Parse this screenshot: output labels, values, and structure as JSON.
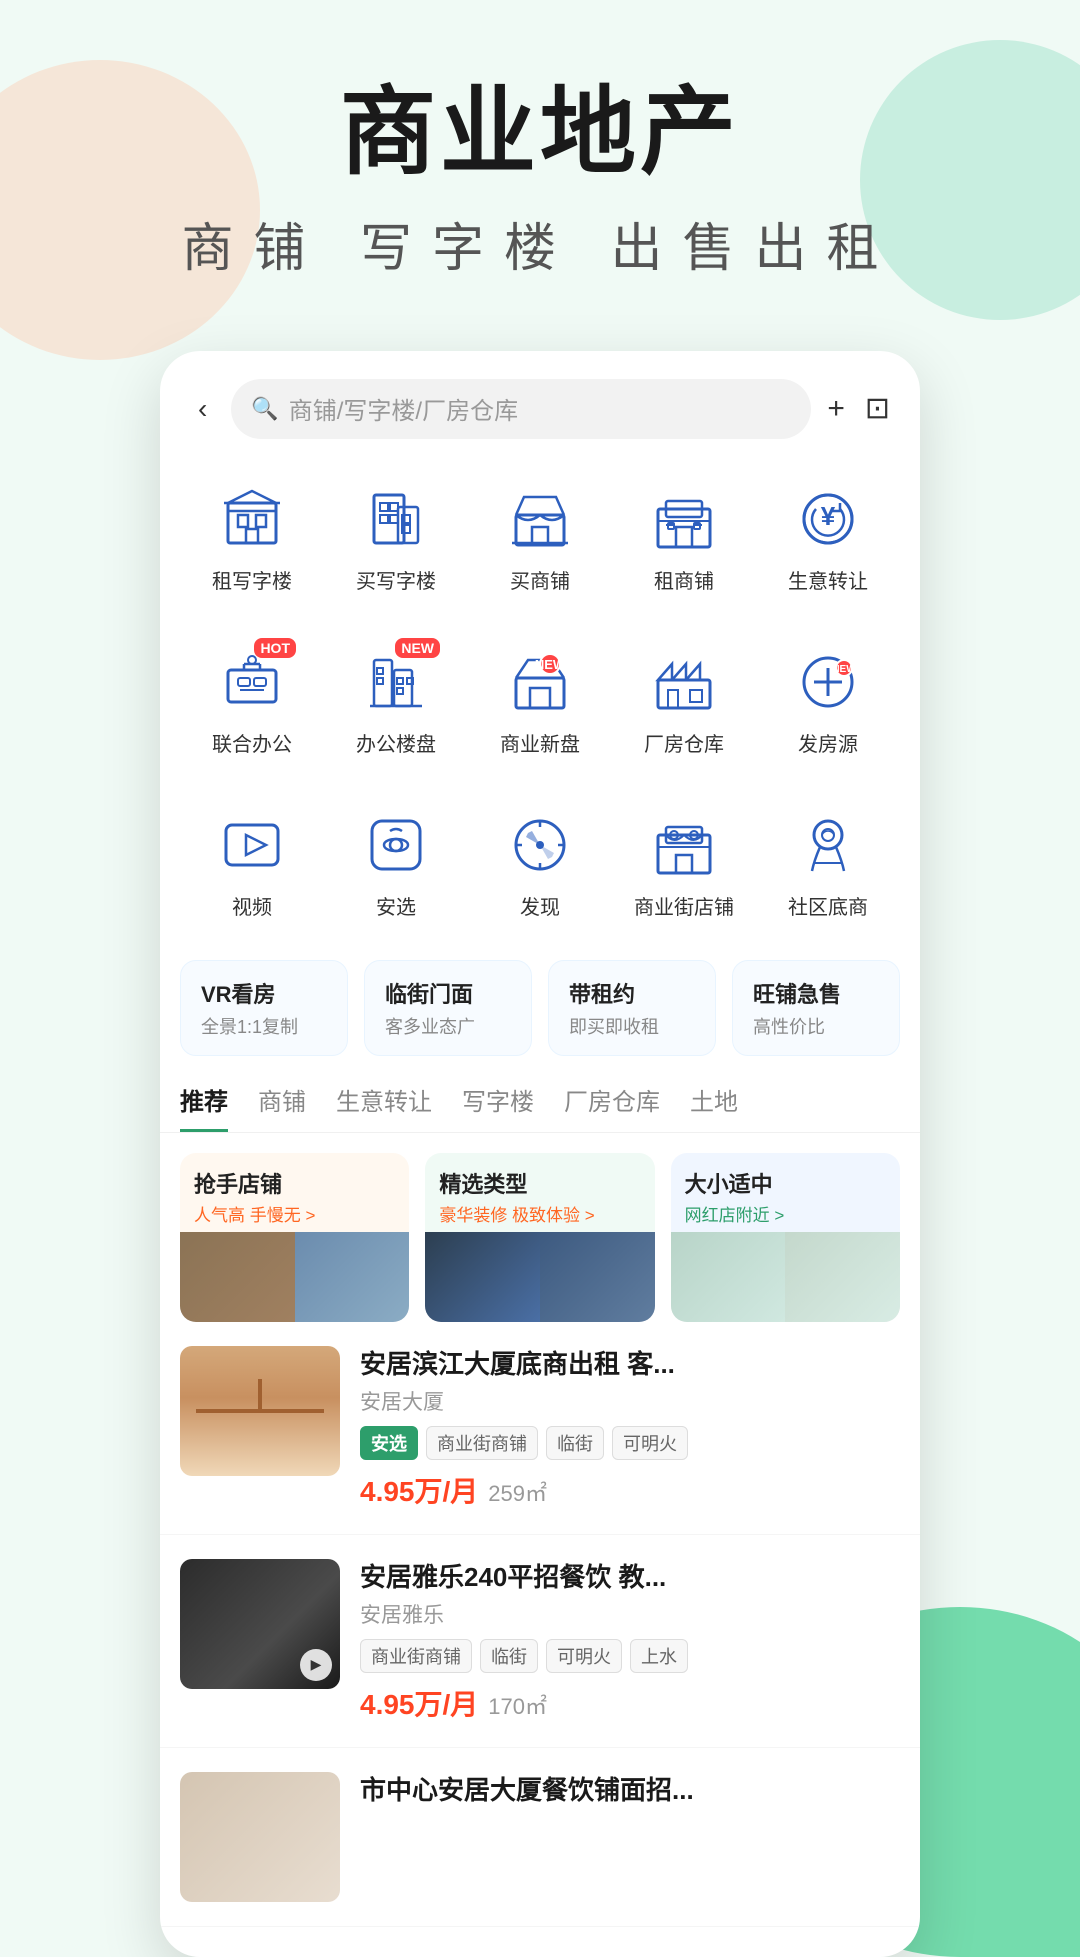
{
  "page": {
    "title": "商业地产",
    "subtitle": "商铺  写字楼  出售出租"
  },
  "topbar": {
    "back_label": "‹",
    "search_placeholder": "商铺/写字楼/厂房仓库",
    "add_icon": "+",
    "message_icon": "⊡"
  },
  "categories_row1": [
    {
      "id": "rent-office",
      "label": "租写字楼",
      "badge": null
    },
    {
      "id": "buy-office",
      "label": "买写字楼",
      "badge": null
    },
    {
      "id": "buy-shop",
      "label": "买商铺",
      "badge": null
    },
    {
      "id": "rent-shop",
      "label": "租商铺",
      "badge": null
    },
    {
      "id": "transfer-biz",
      "label": "生意转让",
      "badge": null
    }
  ],
  "categories_row2": [
    {
      "id": "cowork",
      "label": "联合办公",
      "badge": "HOT"
    },
    {
      "id": "office-disk",
      "label": "办公楼盘",
      "badge": "NEW"
    },
    {
      "id": "commercial-new",
      "label": "商业新盘",
      "badge": "NEW"
    },
    {
      "id": "factory",
      "label": "厂房仓库",
      "badge": null
    },
    {
      "id": "post-source",
      "label": "发房源",
      "badge": "NEW"
    }
  ],
  "categories_row3": [
    {
      "id": "video",
      "label": "视频",
      "badge": null
    },
    {
      "id": "anxuan",
      "label": "安选",
      "badge": null
    },
    {
      "id": "discover",
      "label": "发现",
      "badge": null
    },
    {
      "id": "comm-shop",
      "label": "商业街店铺",
      "badge": null
    },
    {
      "id": "community-shop",
      "label": "社区底商",
      "badge": null
    }
  ],
  "feature_cards": [
    {
      "id": "vr",
      "title": "VR看房",
      "sub": "全景1:1复制"
    },
    {
      "id": "street-front",
      "title": "临街门面",
      "sub": "客多业态广"
    },
    {
      "id": "with-lease",
      "title": "带租约",
      "sub": "即买即收租"
    },
    {
      "id": "hot-sale",
      "title": "旺铺急售",
      "sub": "高性价比"
    }
  ],
  "tabs": [
    {
      "id": "recommend",
      "label": "推荐",
      "active": true
    },
    {
      "id": "shop",
      "label": "商铺",
      "active": false
    },
    {
      "id": "transfer",
      "label": "生意转让",
      "active": false
    },
    {
      "id": "office",
      "label": "写字楼",
      "active": false
    },
    {
      "id": "factory-tab",
      "label": "厂房仓库",
      "active": false
    },
    {
      "id": "land",
      "label": "土地",
      "active": false
    }
  ],
  "collection_cards": [
    {
      "id": "grab-shop",
      "title": "抢手店铺",
      "sub": "人气高 手慢无 >",
      "color": "warm",
      "img1": "img-shop1",
      "img2": "img-shop2"
    },
    {
      "id": "select-type",
      "title": "精选类型",
      "sub": "豪华装修 极致体验 >",
      "color": "green",
      "img1": "img-interior1",
      "img2": "img-interior2"
    },
    {
      "id": "right-size",
      "title": "大小适中",
      "sub": "网红店附近 >",
      "color": "blue",
      "img1": "img-office1",
      "img2": "img-office2"
    }
  ],
  "listings": [
    {
      "id": "listing-1",
      "title": "安居滨江大厦底商出租 客...",
      "source": "安居大厦",
      "tags": [
        {
          "text": "安选",
          "style": "selected"
        },
        {
          "text": "商业街商铺",
          "style": "gray"
        },
        {
          "text": "临街",
          "style": "gray"
        },
        {
          "text": "可明火",
          "style": "gray"
        }
      ],
      "price": "4.95万/月",
      "area": "259㎡",
      "thumb": "clothes",
      "has_video": false
    },
    {
      "id": "listing-2",
      "title": "安居雅乐240平招餐饮 教...",
      "source": "安居雅乐",
      "tags": [
        {
          "text": "商业街商铺",
          "style": "gray"
        },
        {
          "text": "临街",
          "style": "gray"
        },
        {
          "text": "可明火",
          "style": "gray"
        },
        {
          "text": "上水",
          "style": "gray"
        }
      ],
      "price": "4.95万/月",
      "area": "170㎡",
      "thumb": "dark",
      "has_video": true
    },
    {
      "id": "listing-3",
      "title": "市中心安居大厦餐饮铺面招...",
      "source": "",
      "tags": [],
      "price": "",
      "area": "",
      "thumb": "light",
      "has_video": false
    }
  ]
}
